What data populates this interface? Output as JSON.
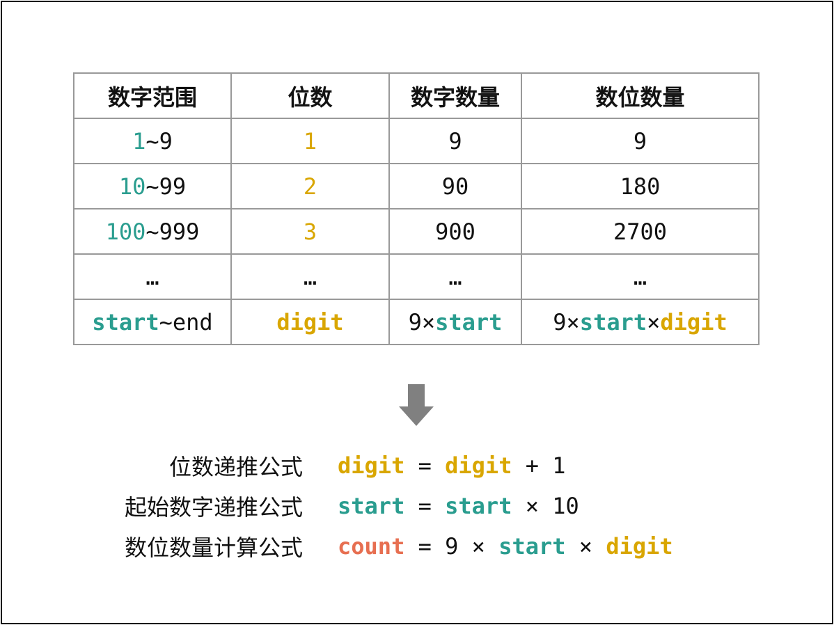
{
  "colors": {
    "start": "#2a9d8f",
    "digit": "#d9a600",
    "count": "#e76f51",
    "text": "#111111",
    "arrow": "#808080"
  },
  "table": {
    "headers": [
      "数字范围",
      "位数",
      "数字数量",
      "数位数量"
    ],
    "rows": [
      [
        [
          {
            "t": "1",
            "c": "start"
          },
          {
            "t": "~9"
          }
        ],
        [
          {
            "t": "1",
            "c": "digit"
          }
        ],
        [
          {
            "t": "9"
          }
        ],
        [
          {
            "t": "9"
          }
        ]
      ],
      [
        [
          {
            "t": "10",
            "c": "start"
          },
          {
            "t": "~99"
          }
        ],
        [
          {
            "t": "2",
            "c": "digit"
          }
        ],
        [
          {
            "t": "90"
          }
        ],
        [
          {
            "t": "180"
          }
        ]
      ],
      [
        [
          {
            "t": "100",
            "c": "start"
          },
          {
            "t": "~999"
          }
        ],
        [
          {
            "t": "3",
            "c": "digit"
          }
        ],
        [
          {
            "t": "900"
          }
        ],
        [
          {
            "t": "2700"
          }
        ]
      ],
      [
        [
          {
            "t": "…"
          }
        ],
        [
          {
            "t": "…"
          }
        ],
        [
          {
            "t": "…"
          }
        ],
        [
          {
            "t": "…"
          }
        ]
      ],
      [
        [
          {
            "t": "start",
            "c": "start",
            "b": true
          },
          {
            "t": "~end"
          }
        ],
        [
          {
            "t": "digit",
            "c": "digit",
            "b": true
          }
        ],
        [
          {
            "t": "9×"
          },
          {
            "t": "start",
            "c": "start",
            "b": true
          }
        ],
        [
          {
            "t": "9×"
          },
          {
            "t": "start",
            "c": "start",
            "b": true
          },
          {
            "t": "×"
          },
          {
            "t": "digit",
            "c": "digit",
            "b": true
          }
        ]
      ]
    ]
  },
  "arrow_icon": "down-arrow",
  "formulas": [
    {
      "label": "位数递推公式",
      "expr": [
        {
          "t": "digit",
          "c": "digit",
          "b": true
        },
        {
          "t": " = "
        },
        {
          "t": "digit",
          "c": "digit",
          "b": true
        },
        {
          "t": " + 1"
        }
      ]
    },
    {
      "label": "起始数字递推公式",
      "expr": [
        {
          "t": "start",
          "c": "start",
          "b": true
        },
        {
          "t": " = "
        },
        {
          "t": "start",
          "c": "start",
          "b": true
        },
        {
          "t": " × 10"
        }
      ]
    },
    {
      "label": "数位数量计算公式",
      "expr": [
        {
          "t": "count",
          "c": "count",
          "b": true
        },
        {
          "t": " = 9 × "
        },
        {
          "t": "start",
          "c": "start",
          "b": true
        },
        {
          "t": " × "
        },
        {
          "t": "digit",
          "c": "digit",
          "b": true
        }
      ]
    }
  ]
}
